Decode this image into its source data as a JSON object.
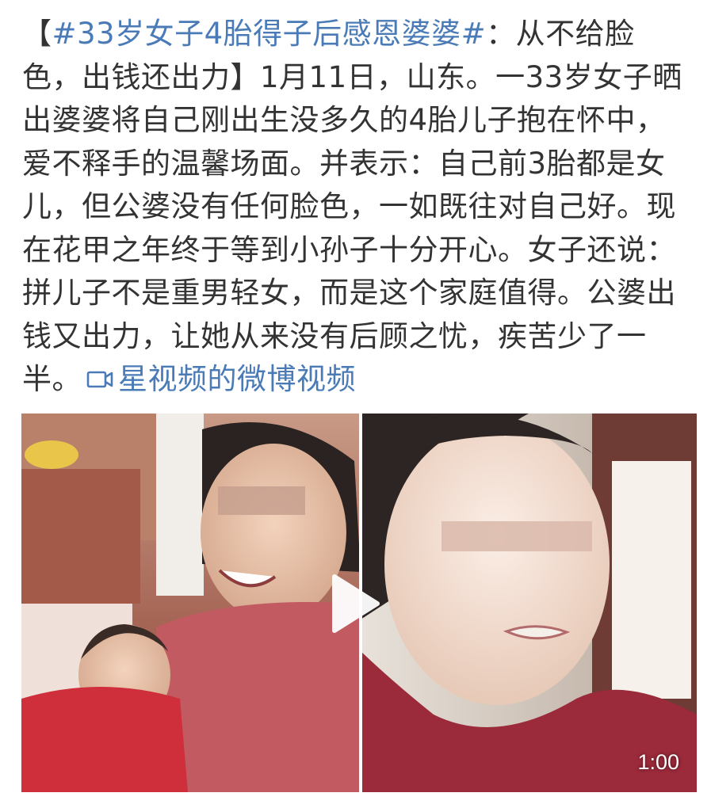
{
  "post": {
    "bracket_open": "【",
    "hashtag": "#33岁女子4胎得子后感恩婆婆#",
    "body": "：从不给脸色，出钱还出力】1月11日，山东。一33岁女子晒出婆婆将自己刚出生没多久的4胎儿子抱在怀中，爱不释手的温馨场面。并表示：自己前3胎都是女儿，但公婆没有任何脸色，一如既往对自己好。现在花甲之年终于等到小孙子十分开心。女子还说：拼儿子不是重男轻女，而是这个家庭值得。公婆出钱又出力，让她从来没有后顾之忧，疾苦少了一半。",
    "video_link_icon": "video-camera-icon",
    "video_link_label": "星视频的微博视频"
  },
  "video": {
    "duration": "1:00",
    "play_icon": "play-icon"
  },
  "colors": {
    "link": "#4a7bb7",
    "text": "#333333"
  }
}
